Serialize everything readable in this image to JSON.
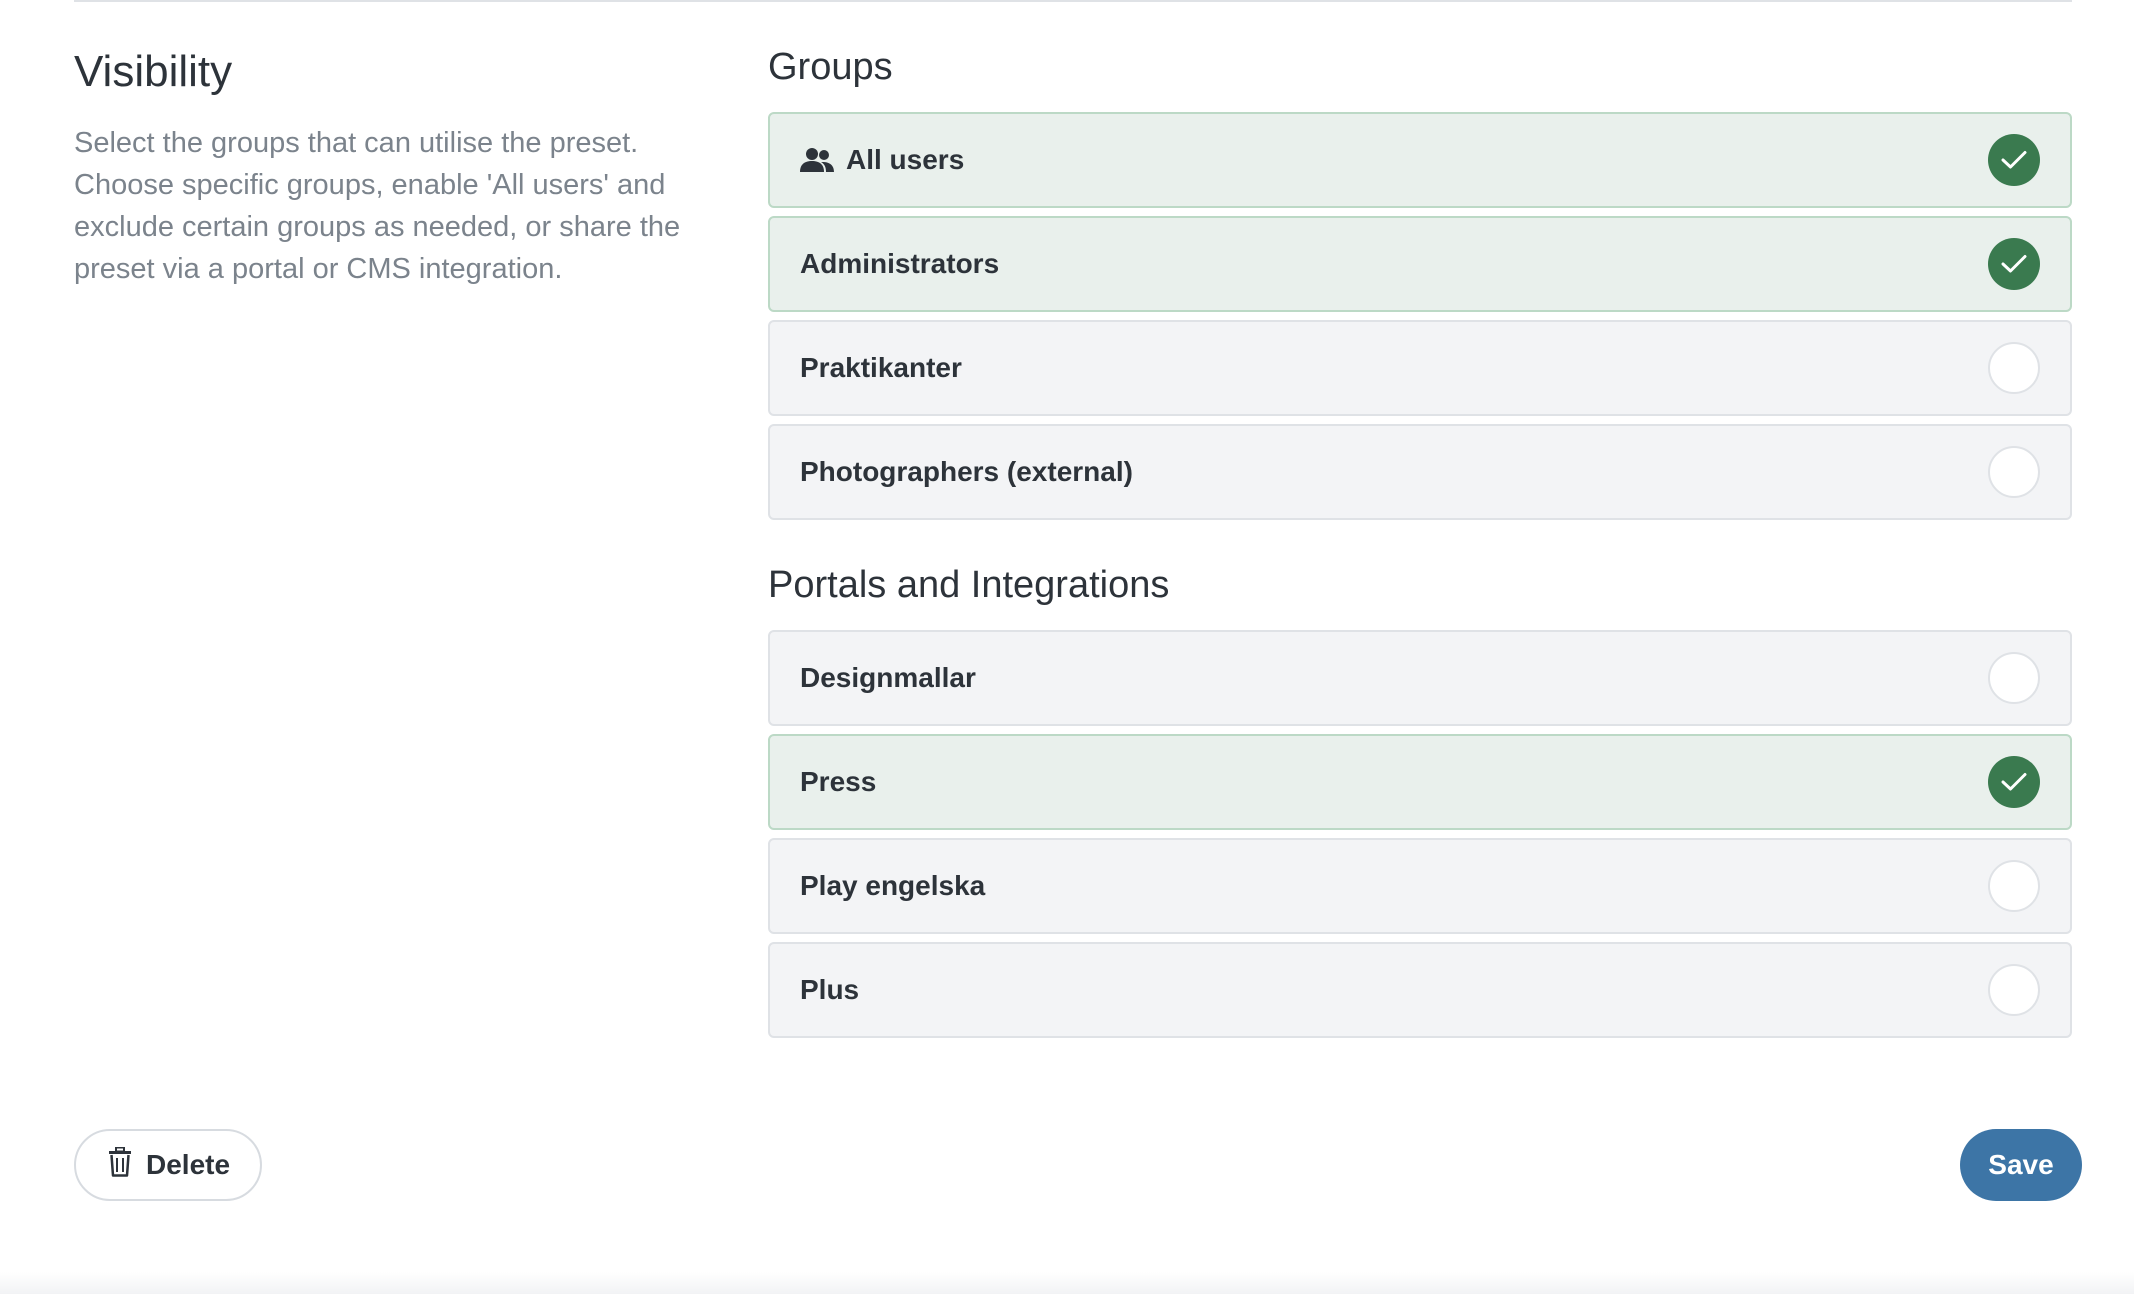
{
  "visibility": {
    "title": "Visibility",
    "description": "Select the groups that can utilise the preset. Choose specific groups, enable 'All users' and exclude certain groups as needed, or share the preset via a portal or CMS integration."
  },
  "groups": {
    "heading": "Groups",
    "items": [
      {
        "label": "All users",
        "selected": true,
        "icon": "users-icon"
      },
      {
        "label": "Administrators",
        "selected": true
      },
      {
        "label": "Praktikanter",
        "selected": false
      },
      {
        "label": "Photographers (external)",
        "selected": false
      }
    ]
  },
  "portals": {
    "heading": "Portals and Integrations",
    "items": [
      {
        "label": "Designmallar",
        "selected": false
      },
      {
        "label": "Press",
        "selected": true
      },
      {
        "label": "Play engelska",
        "selected": false
      },
      {
        "label": "Plus",
        "selected": false
      }
    ]
  },
  "actions": {
    "delete_label": "Delete",
    "delete_icon": "trash-icon",
    "save_label": "Save"
  },
  "colors": {
    "selected_background": "#e9f0ec",
    "check_on": "#3a7a4f",
    "save_button": "#3d75a6"
  }
}
